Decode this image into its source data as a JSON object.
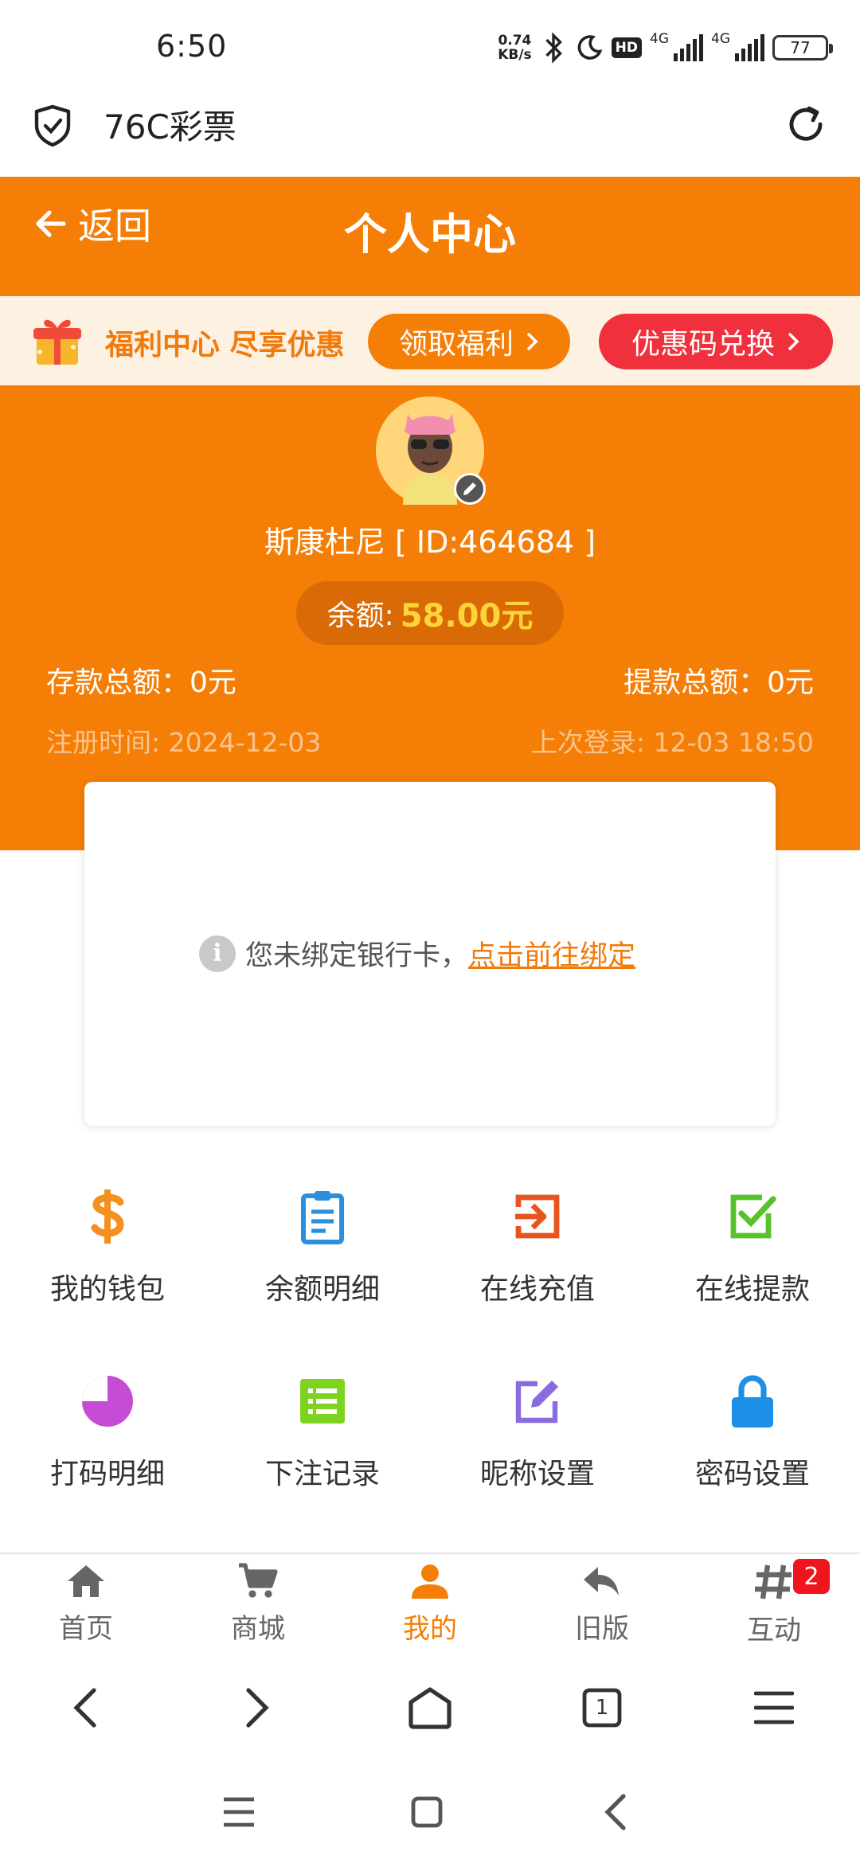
{
  "status_bar": {
    "time": "6:50",
    "net_speed_value": "0.74",
    "net_speed_unit": "KB/s",
    "hd_label": "HD",
    "signal1_label": "4G",
    "signal2_label": "4G",
    "battery": "77"
  },
  "browser": {
    "site_title": "76C彩票",
    "icons": [
      "shield-check-icon",
      "refresh-icon"
    ]
  },
  "header": {
    "back_label": "返回",
    "title": "个人中心"
  },
  "welfare": {
    "text": "福利中心 尽享优惠",
    "claim_label": "领取福利",
    "coupon_label": "优惠码兑换"
  },
  "profile": {
    "username": "斯康杜尼 [ ID:464684 ]",
    "balance_label": "余额:",
    "balance_value": "58.00元",
    "deposit_total": "存款总额：0元",
    "withdraw_total": "提款总额：0元",
    "register_time": "注册时间: 2024-12-03",
    "last_login": "上次登录: 12-03 18:50"
  },
  "bank": {
    "message": "您未绑定银行卡，",
    "link_label": "点击前往绑定"
  },
  "menu": [
    {
      "label": "我的钱包",
      "icon": "dollar-icon",
      "color": "#f5901e"
    },
    {
      "label": "余额明细",
      "icon": "clipboard-icon",
      "color": "#2a8fdd"
    },
    {
      "label": "在线充值",
      "icon": "sign-in-icon",
      "color": "#e8541e"
    },
    {
      "label": "在线提款",
      "icon": "checkbox-icon",
      "color": "#58c22a"
    },
    {
      "label": "打码明细",
      "icon": "pie-chart-icon",
      "color": "#c64cd6"
    },
    {
      "label": "下注记录",
      "icon": "list-icon",
      "color": "#7ed321"
    },
    {
      "label": "昵称设置",
      "icon": "edit-icon",
      "color": "#8a6ce0"
    },
    {
      "label": "密码设置",
      "icon": "lock-icon",
      "color": "#1e8fe6"
    }
  ],
  "tabs": [
    {
      "label": "首页",
      "icon": "home-icon"
    },
    {
      "label": "商城",
      "icon": "cart-icon"
    },
    {
      "label": "我的",
      "icon": "user-icon",
      "active": true
    },
    {
      "label": "旧版",
      "icon": "reply-icon"
    },
    {
      "label": "互动",
      "icon": "hashtag-icon",
      "badge": "2"
    }
  ],
  "browser_nav": {
    "tab_count": "1"
  },
  "colors": {
    "accent": "#f57e07",
    "coupon": "#f0303c",
    "balance": "#ffd43a"
  }
}
